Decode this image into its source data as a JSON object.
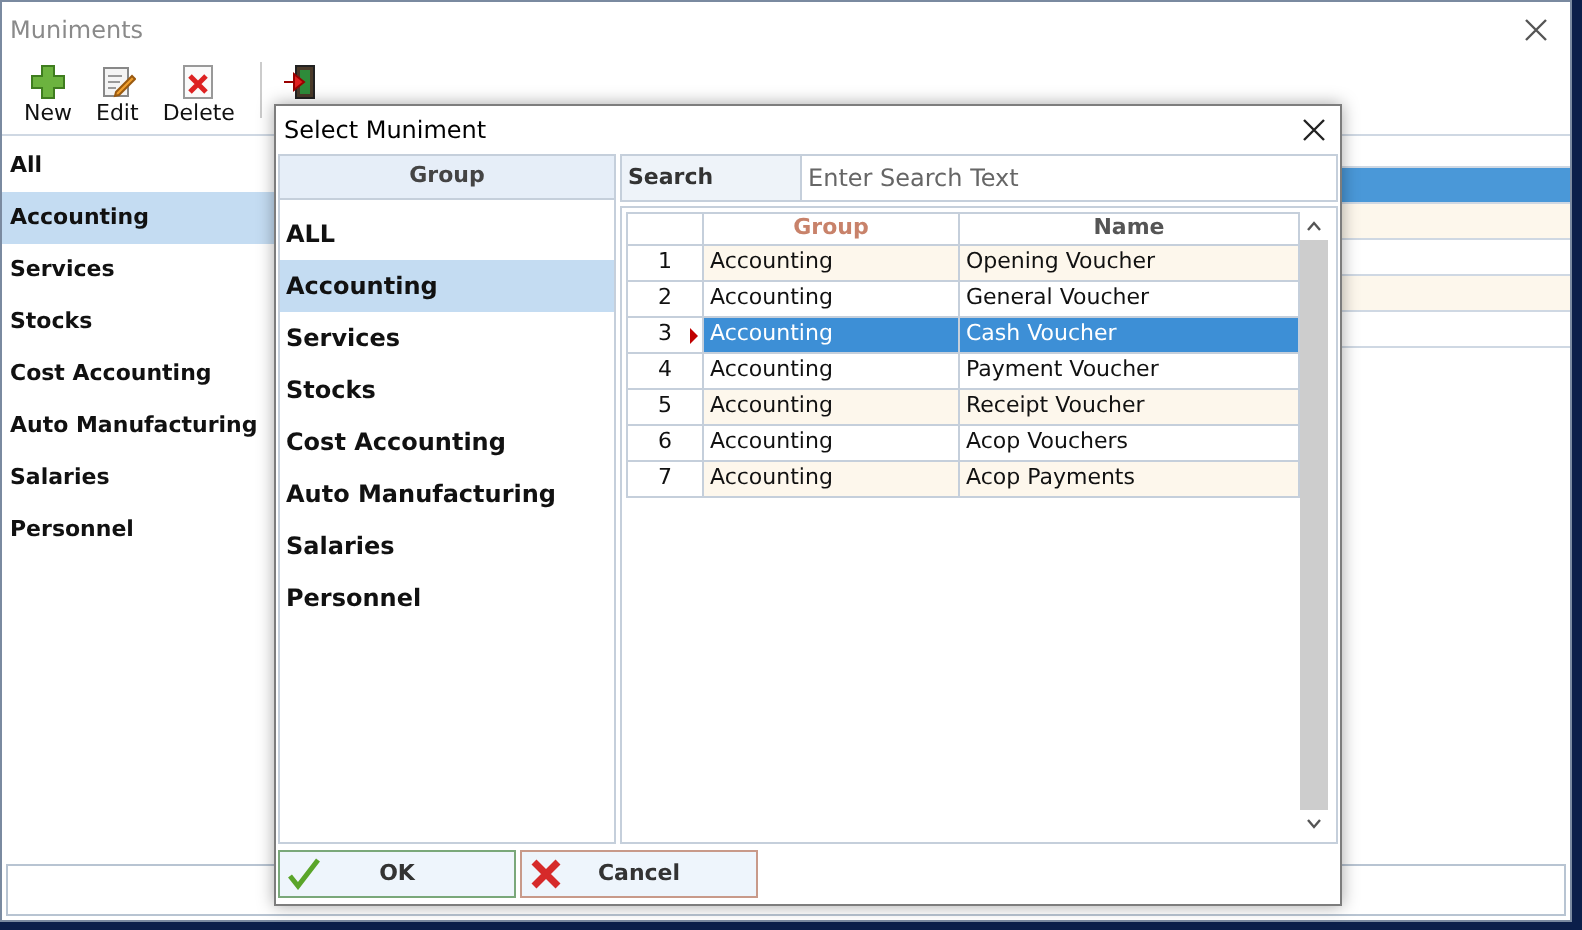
{
  "main_window": {
    "title": "Muniments",
    "toolbar": [
      {
        "label": "New",
        "kind": "new"
      },
      {
        "label": "Edit",
        "kind": "edit"
      },
      {
        "label": "Delete",
        "kind": "delete"
      },
      {
        "kind": "exit"
      }
    ],
    "groups": [
      {
        "label": "All",
        "selected": false
      },
      {
        "label": "Accounting",
        "selected": true
      },
      {
        "label": "Services",
        "selected": false
      },
      {
        "label": "Stocks",
        "selected": false
      },
      {
        "label": "Cost Accounting",
        "selected": false
      },
      {
        "label": "Auto Manufacturing",
        "selected": false
      },
      {
        "label": "Salaries",
        "selected": false
      },
      {
        "label": "Personnel",
        "selected": false
      }
    ],
    "grid_rows": [
      {
        "selected": true
      },
      {
        "selected": false
      },
      {
        "selected": false
      },
      {
        "selected": false
      },
      {
        "selected": false
      }
    ]
  },
  "dialog": {
    "title": "Select Muniment",
    "groups_header": "Group",
    "groups": [
      {
        "label": "ALL",
        "selected": false
      },
      {
        "label": "Accounting",
        "selected": true
      },
      {
        "label": "Services",
        "selected": false
      },
      {
        "label": "Stocks",
        "selected": false
      },
      {
        "label": "Cost Accounting",
        "selected": false
      },
      {
        "label": "Auto Manufacturing",
        "selected": false
      },
      {
        "label": "Salaries",
        "selected": false
      },
      {
        "label": "Personnel",
        "selected": false
      }
    ],
    "search": {
      "label": "Search",
      "placeholder": "Enter Search Text"
    },
    "columns": [
      "Group",
      "Name"
    ],
    "rows": [
      {
        "number": "1",
        "group": "Accounting",
        "name": "Opening Voucher",
        "selected": false
      },
      {
        "number": "2",
        "group": "Accounting",
        "name": "General Voucher",
        "selected": false
      },
      {
        "number": "3",
        "group": "Accounting",
        "name": "Cash Voucher",
        "selected": true
      },
      {
        "number": "4",
        "group": "Accounting",
        "name": "Payment Voucher",
        "selected": false
      },
      {
        "number": "5",
        "group": "Accounting",
        "name": "Receipt Voucher",
        "selected": false
      },
      {
        "number": "6",
        "group": "Accounting",
        "name": "Acop Vouchers",
        "selected": false
      },
      {
        "number": "7",
        "group": "Accounting",
        "name": "Acop Payments",
        "selected": false
      }
    ],
    "buttons": [
      {
        "label": "OK",
        "kind": "ok"
      },
      {
        "label": "Cancel",
        "kind": "cancel"
      }
    ]
  }
}
